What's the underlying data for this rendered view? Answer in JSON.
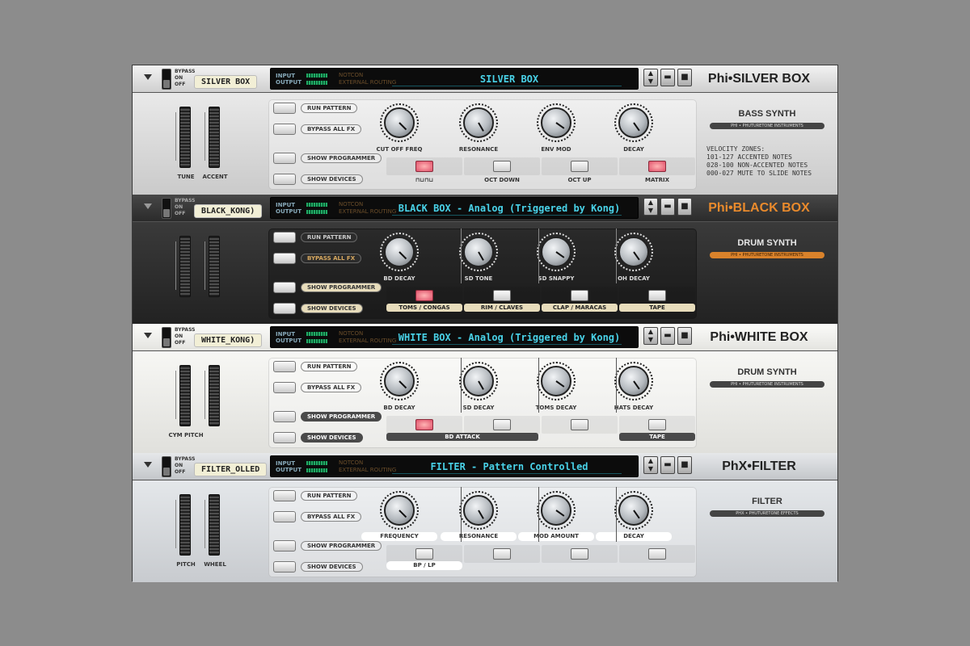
{
  "header_common": {
    "bypass_labels": [
      "BYPASS",
      "ON",
      "OFF"
    ],
    "input_label": "INPUT",
    "output_label": "OUTPUT",
    "routing": [
      "NOTCON",
      "EXTERNAL ROUTING"
    ],
    "up_arrow": "▲",
    "down_arrow": "▼",
    "folder_icon": "▬",
    "save_icon": "■"
  },
  "devices": [
    {
      "theme": "silver",
      "label": "SILVER BOX",
      "name": "SILVER BOX",
      "title": "Phi•SILVER BOX",
      "wheels": [
        "TUNE",
        "ACCENT"
      ],
      "buttons": [
        "RUN PATTERN",
        "BYPASS ALL FX",
        "SHOW PROGRAMMER",
        "SHOW DEVICES"
      ],
      "knobs": [
        "CUT OFF FREQ",
        "RESONANCE",
        "ENV MOD",
        "DECAY"
      ],
      "steps": [
        {
          "label": "waveform",
          "on": true
        },
        {
          "label": "OCT DOWN",
          "on": false
        },
        {
          "label": "OCT UP",
          "on": false
        },
        {
          "label": "MATRIX",
          "on": true
        }
      ],
      "waveform_icon": "⊓⊔⊓⊔",
      "section_title": "BASS SYNTH",
      "brand": "PHI • PHUTURETONE INSTRUMENTS",
      "velocity": [
        "VELOCITY ZONES:",
        "101-127 ACCENTED NOTES",
        "028-100 NON-ACCENTED NOTES",
        "000-027 MUTE TO SLIDE NOTES"
      ]
    },
    {
      "theme": "black",
      "label": "BLACK_KONG)",
      "name": "BLACK BOX - Analog (Triggered by Kong)",
      "title": "Phi•BLACK BOX",
      "wheels": [],
      "buttons": [
        "RUN PATTERN",
        "BYPASS ALL FX",
        "SHOW PROGRAMMER",
        "SHOW DEVICES"
      ],
      "knobs": [
        "BD DECAY",
        "SD TONE",
        "SD SNAPPY",
        "OH DECAY"
      ],
      "steps": [
        {
          "label": "TOMS / CONGAS",
          "on": true
        },
        {
          "label": "RIM / CLAVES",
          "on": false
        },
        {
          "label": "CLAP / MARACAS",
          "on": false
        },
        {
          "label": "TAPE",
          "on": false
        }
      ],
      "section_title": "DRUM SYNTH",
      "brand": "PHI • PHUTURETONE INSTRUMENTS"
    },
    {
      "theme": "white",
      "label": "WHITE_KONG)",
      "name": "WHITE BOX - Analog (Triggered by Kong)",
      "title": "Phi•WHITE BOX",
      "wheels": [
        "CYM PITCH"
      ],
      "buttons": [
        "RUN PATTERN",
        "BYPASS ALL FX",
        "SHOW PROGRAMMER",
        "SHOW DEVICES"
      ],
      "knobs": [
        "BD DECAY",
        "SD DECAY",
        "TOMS DECAY",
        "HATS DECAY"
      ],
      "steps": [
        {
          "label": "BD ATTACK",
          "on": true
        },
        {
          "label": "",
          "on": false
        },
        {
          "label": "",
          "on": false
        },
        {
          "label": "TAPE",
          "on": false
        }
      ],
      "section_title": "DRUM SYNTH",
      "brand": "PHI • PHUTURETONE INSTRUMENTS"
    },
    {
      "theme": "filter",
      "label": "FILTER_OLLED",
      "name": "FILTER - Pattern Controlled",
      "title": "PhX•FILTER",
      "wheels": [
        "PITCH",
        "WHEEL"
      ],
      "buttons": [
        "RUN PATTERN",
        "BYPASS ALL FX",
        "SHOW PROGRAMMER",
        "SHOW DEVICES"
      ],
      "knobs": [
        "FREQUENCY",
        "RESONANCE",
        "MOD AMOUNT",
        "DECAY"
      ],
      "steps": [
        {
          "label": "BP / LP",
          "on": false
        },
        {
          "label": "",
          "on": false
        },
        {
          "label": "",
          "on": false
        },
        {
          "label": "",
          "on": false
        }
      ],
      "section_title": "FILTER",
      "brand": "PHX • PHUTURETONE EFFECTS"
    }
  ]
}
